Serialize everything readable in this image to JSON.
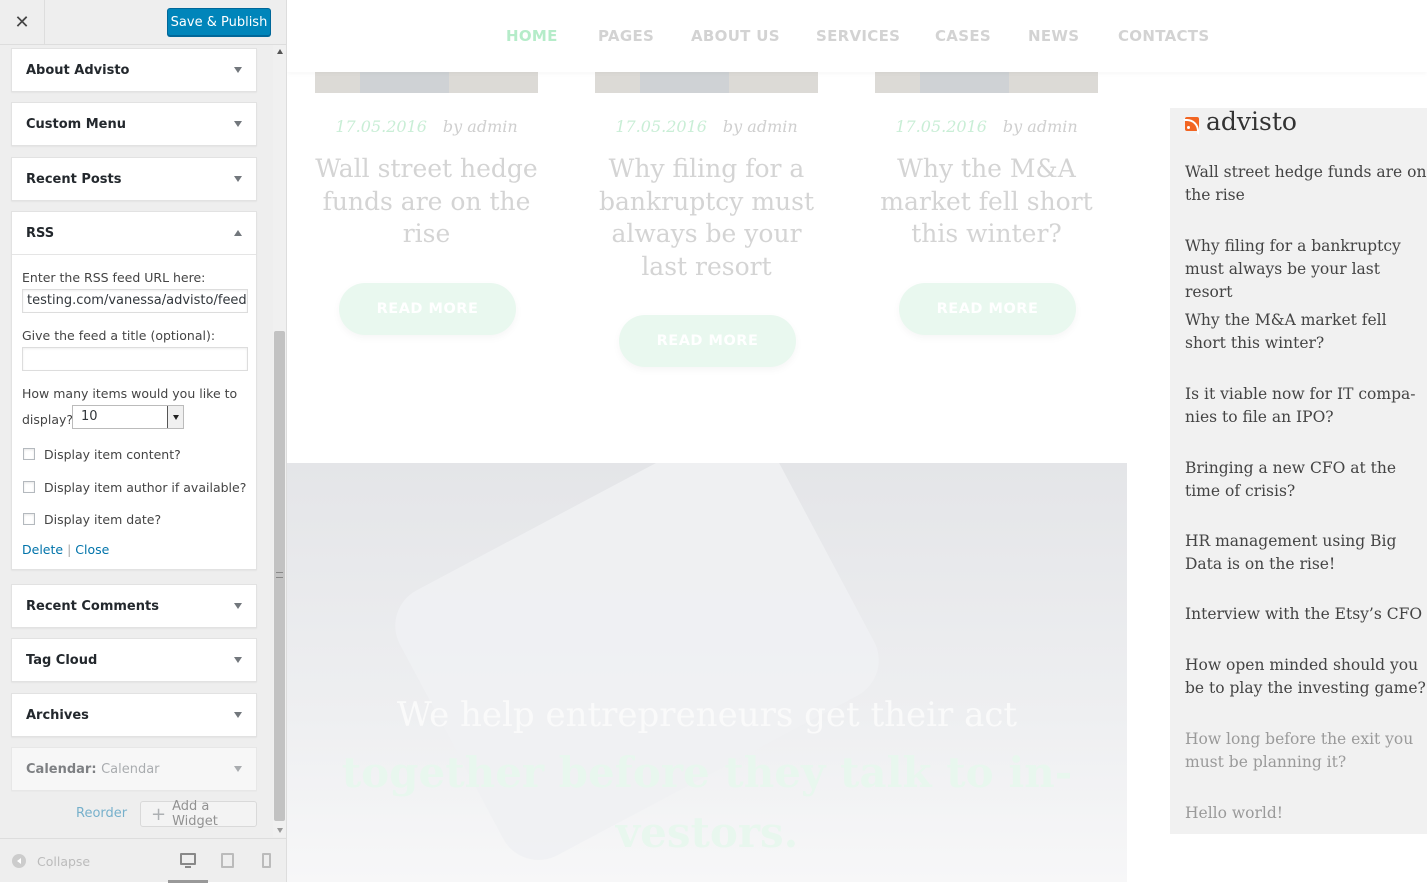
{
  "customizer": {
    "close_symbol": "✕",
    "publish_label": "Save & Publish",
    "widgets": [
      {
        "label": "About Advisto"
      },
      {
        "label": "Custom Menu"
      },
      {
        "label": "Recent Posts"
      },
      {
        "label": "RSS"
      },
      {
        "label": "Recent Comments"
      },
      {
        "label": "Tag Cloud"
      },
      {
        "label": "Archives"
      },
      {
        "label": "Calendar:",
        "sub": "Calendar"
      }
    ],
    "rss_form": {
      "url_label": "Enter the RSS feed URL here:",
      "url_value": "testing.com/vanessa/advisto/feed",
      "title_label": "Give the feed a title (optional):",
      "title_value": "",
      "items_label_1": "How many items would you like to",
      "items_label_2": "display?",
      "items_value": "10",
      "check_content": "Display item content?",
      "check_author": "Display item author if available?",
      "check_date": "Display item date?",
      "delete_link": "Delete",
      "separator": "|",
      "close_link": "Close"
    },
    "reorder_label": "Reorder",
    "add_widget_label": "Add a Widget",
    "collapse_label": "Collapse"
  },
  "preview": {
    "nav": [
      "HOME",
      "PAGES",
      "ABOUT US",
      "SERVICES",
      "CASES",
      "NEWS",
      "CONTACTS"
    ],
    "posts": [
      {
        "date": "17.05.2016",
        "by": "by admin",
        "title": "Wall street hedge funds are on the rise",
        "button": "READ MORE"
      },
      {
        "date": "17.05.2016",
        "by": "by admin",
        "title": "Why filing for a bankruptcy must always be your last resort",
        "button": "READ MORE"
      },
      {
        "date": "17.05.2016",
        "by": "by admin",
        "title": "Why the M&A market fell short this winter?",
        "button": "READ MORE"
      }
    ],
    "hero": {
      "line1": "We help entrepreneurs get their act",
      "line2": "together before they talk to in-vestors."
    },
    "rss_widget": {
      "title": "advisto",
      "items": [
        "Wall street hedge funds are on the rise",
        "Why filing for a bankruptcy must always be your last resort",
        "Why the M&A market fell short this winter?",
        "Is it viable now for IT compa-nies to file an IPO?",
        "Bringing a new CFO at the time of crisis?",
        "HR management using Big Data is on the rise!",
        "Interview with the Etsy’s CFO",
        "How open minded should you be to play the investing game?",
        "How long before the exit you must be planning it?",
        "Hello world!"
      ]
    }
  },
  "colors": {
    "publish_button": "#0085ba",
    "link": "#0073aa",
    "nav_active": "#b5ecc9",
    "read_more_bg": "#e9f8ef",
    "rss_icon": "#f26522"
  }
}
